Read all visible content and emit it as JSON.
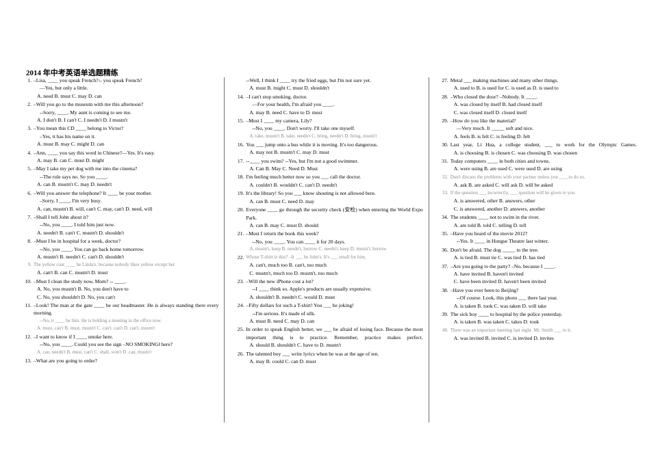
{
  "document": {
    "title": "2014 年中考英语单选题精练"
  },
  "columns": [
    {
      "id": "column-1",
      "questions": [
        {
          "num": "1.",
          "lines": [
            "–Lisa, ____ you speak French?-- you speak French?",
            "—Yes, but only a little."
          ],
          "options": "A. need   B. must    C. may     D. can"
        },
        {
          "num": "2.",
          "lines": [
            "–Will you go to the museum with me this afternoon?",
            "--Sorry, ____. My aunt is coming to see me."
          ],
          "options": "A. I don't     B. I can't   C. I needn't    D. I mustn't"
        },
        {
          "num": "3.",
          "lines": [
            "–You mean this CD ____ belong to Victor?",
            "–Yes, it has his name on it."
          ],
          "options": "A. must   B. may    C. might   D. can"
        },
        {
          "num": "4.",
          "lines": [
            "–Ann, ____ you say this word in Chinese?—Yes. It's easy."
          ],
          "options": "A. may    B. can    C. must   D. might"
        },
        {
          "num": "5.",
          "lines": [
            "–May I take my pet dog with me into the cinema?",
            "--The rule says no. So you ____."
          ],
          "options": "A. can    B. mustn't   C. may    D. needn't"
        },
        {
          "num": "6.",
          "lines": [
            "–Will you answer the telephone? It ____ be your mother.",
            "–Sorry, I ____. I'm very busy."
          ],
          "options": "A. can, mustn't   B. will, can't   C. may, can't   D. need, will"
        },
        {
          "num": "7.",
          "lines": [
            "–Shall I tell John about it?",
            "--No, you ____. I told him just now."
          ],
          "options": "A. needn't    B. can't    C. mustn't    D. shouldn't"
        },
        {
          "num": "8.",
          "lines": [
            "–Must I be in hospital for a week, doctor?",
            "--No, you ____. You can go back home tomorrow."
          ],
          "options": "A. mustn't   B. needn't    C. can't    D. shouldn't"
        },
        {
          "num": "9.",
          "faded_stem": true,
          "lines": [
            "The yellow coat ____ be Linda's, because nobody likes yellow except her."
          ],
          "options": "A. can't    B. can    C. mustn't    D. must"
        },
        {
          "num": "10.",
          "lines": [
            "–Must I clean the study now, Mom? -- ____."
          ],
          "options": "A. No, you mustn't          B. No, you don't have to",
          "options2": "C. No, you shouldn't        D. No, you can't"
        },
        {
          "num": "11.",
          "lines": [
            "–Look! The man at the gate ____ be our headmaster. He is always standing there every morning."
          ],
          "faded_lines": [
            "--No, it ____ be him. He is holding a meeting in the office now."
          ],
          "faded_options": "A. must, can't    B. must, mustn't   C. can't. can't   D. can't, mustn't"
        },
        {
          "num": "12.",
          "lines": [
            "–I want to know if I ____ smoke here.",
            "--No, you ____. Could you see the sign –NO SMOKING‖ here?"
          ],
          "faded_options": "A. can, needn't   B. must, can't   C. shall, won't   D. can, mustn't"
        },
        {
          "num": "13.",
          "lines": [
            "–What are you going to order?"
          ],
          "options": ""
        }
      ]
    },
    {
      "id": "column-2",
      "questions": [
        {
          "num": "",
          "lines": [
            "--Well, I think I ____ try the fried eggs, but I'm not sure yet."
          ],
          "options": "A. must     B. might     C. must    D. shouldn't"
        },
        {
          "num": "14.",
          "lines": [
            "–I can't stop smoking, doctor.",
            "—For your health, I'm afraid you ____."
          ],
          "options": "A. may     B. need     C. have to   D. must"
        },
        {
          "num": "15.",
          "lines": [
            "–Must I ____ my camera, Lily?",
            "--No, you ____. Don't worry. I'll take one myself."
          ],
          "faded_options": "A. take, mustn't B. take, needn't C. bring, needn't D. bring, mustn't"
        },
        {
          "num": "16.",
          "lines": [
            "You ___ jump onto a bus while it is moving. It's too dangerous."
          ],
          "options": "A. may not    B. mustn't    C. may    D. must"
        },
        {
          "num": "17.",
          "lines": [
            "--____ you swim?   --Yes, but I'm not a good swimmer."
          ],
          "options": "A. Can    B. May    C. Need     D. Must"
        },
        {
          "num": "18.",
          "lines": [
            "I'm feeling much better now so you ___ call the doctor."
          ],
          "options": "A. couldn't   B. wouldn't   C. can't    D. needn't"
        },
        {
          "num": "19.",
          "lines": [
            "It's the library! So you ___ know shouting is not allowed here."
          ],
          "options": "A. can     B. must     C. need    D. may"
        },
        {
          "num": "20.",
          "lines": [
            "Everyone ____ go through the security check (安检) when entering the World Expo Park."
          ],
          "options": "A. can      B. may     C. must    D. should"
        },
        {
          "num": "21.",
          "lines": [
            "–Must I return the book this week?",
            "--No, you ____. You can ____ it for 20 days."
          ],
          "faded_options": "A. mustn't, keep B. needn't, borrow C. needn't, keep D. mustn't, borrow"
        },
        {
          "num": "22.",
          "faded_stem": true,
          "lines": [
            "Whose T-shirt is this?  –It ___ be John's. It's ___ small for him."
          ],
          "options": "A. can't, much too          B. can't, too much",
          "options2": "C. mustn't, much too        D. mustn't, too much"
        },
        {
          "num": "23.",
          "lines": [
            "–Will the new iPhone cost a lot?",
            "--I ____ think so. Apple's products are usually expensive."
          ],
          "options": "A. shouldn't   B. needn't   C. would     D. must"
        },
        {
          "num": "24.",
          "lines": [
            "–Fifty dollars for such a T-shirt! You ___ be joking!",
            "--I'm serious. It's made of silk."
          ],
          "options": "A. must     B. need   C. may    D. can"
        },
        {
          "num": "25.",
          "lines": [
            "In order to speak English better, we ___ be afraid of losing face. Because the most important thing is to practice. Remember, practice makes perfect."
          ],
          "options": "A. should     B. shouldn't   C. have to    D. mustn't"
        },
        {
          "num": "26.",
          "lines": [
            "The talented boy ___ write lyrics when he was at the age of ten."
          ],
          "options": "A. may     B. could     C. can    D. must"
        }
      ]
    },
    {
      "id": "column-3",
      "questions": [
        {
          "num": "27.",
          "lines": [
            "Metal ___ making machines and many other things."
          ],
          "options": "A. used to  B. is used for   C. is used as    D. is used to"
        },
        {
          "num": "28.",
          "lines": [
            "–Who closed the door? –Nobody. It ____."
          ],
          "options": "A. was closed by itself     B. had closed itself",
          "options2": "C. was closed itself        D. closed itself"
        },
        {
          "num": "29.",
          "lines": [
            "–How do you like the material?",
            "—Very much. It _____ soft and nice."
          ],
          "options": "A. feels    B. is felt   C. is feeling    D. felt"
        },
        {
          "num": "30.",
          "lines": [
            "Last year, Li Hua, a college student, ___ to work for the Olympic Games."
          ],
          "options": "A. is choosing B. is chosen   C. was choosing   D. was chosen"
        },
        {
          "num": "31.",
          "lines": [
            "Today computers ____ in both cities and towns."
          ],
          "options": "A. were using   B. are used   C. were used   D. are using"
        },
        {
          "num": "32.",
          "faded_stem": true,
          "lines": [
            "Don't discuss the problems with your partner unless you ____to do so."
          ],
          "options": "A. ask    B. are asked    C. will ask    D. will be asked"
        },
        {
          "num": "33.",
          "faded_stem": true,
          "lines": [
            "If the question ___ incorrectly, ___ question will be given to you."
          ],
          "options": "A. is answered, other        B. answers, other",
          "options2": "C. is answered, another      D. answers, another"
        },
        {
          "num": "34.",
          "lines": [
            "The students ____ not to swim in the river."
          ],
          "options": "A. are told    B. told    C. telling    D. tell"
        },
        {
          "num": "35.",
          "lines": [
            "–Have you heard of the movie 2012?",
            "--Yes. It ____ in Hongse Theatre last winter."
          ]
        },
        {
          "num": "36.",
          "lines": [
            "Don't be afraid. The dog _____ to the tree."
          ],
          "options": "A. is tied   B. must tie    C. was tied   D. has tied"
        },
        {
          "num": "37.",
          "lines": [
            "–Are you going to the party? –No, because I ____."
          ],
          "options": "A. have invited           B. haven't invited",
          "options2": "C. have been invited      D. haven't been invited"
        },
        {
          "num": "38.",
          "lines": [
            "–Have you ever been to Beijing?",
            "--Of course. Look, this photo ___ there last year."
          ],
          "options": "A. is taken   B. took    C. was taken    D. will take"
        },
        {
          "num": "39.",
          "lines": [
            "The sick boy ____ to hospital by the police yesterday."
          ],
          "options": "A. is taken   B. was taken   C. takes    D. took"
        },
        {
          "num": "40.",
          "faded_stem": true,
          "lines": [
            "There was an important meeting last night. Mr. Smith ___ to it."
          ],
          "options": "A. was invited   B. invited     C. is invited    D. invites"
        }
      ]
    }
  ]
}
